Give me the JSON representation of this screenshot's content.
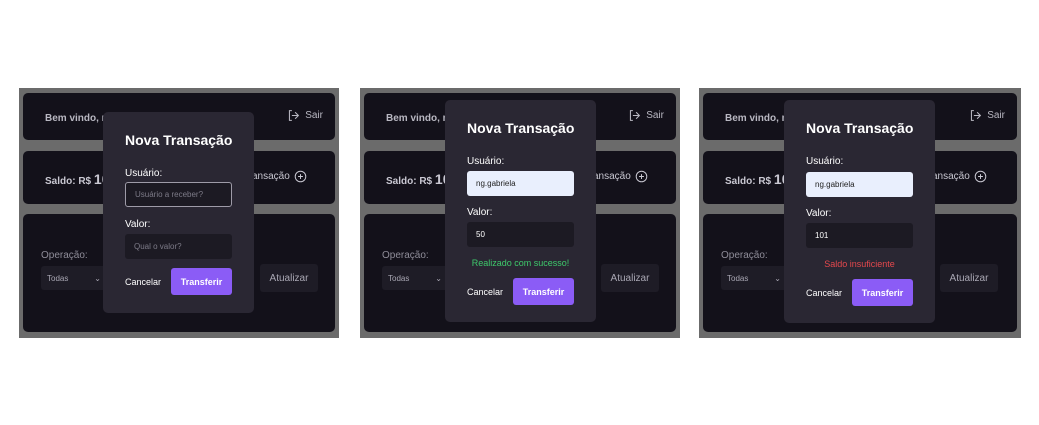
{
  "dashboard": {
    "greeting": "Bem vindo, n",
    "logout_label": "Sair",
    "balance_label": "Saldo: R$",
    "balance_value": "10",
    "new_transaction_label": "ansação",
    "operation_label": "Operação:",
    "operation_selected": "Todas",
    "refresh_label": "Atualizar"
  },
  "modals": [
    {
      "title": "Nova Transação",
      "user_label": "Usuário:",
      "user_value": "",
      "user_placeholder": "Usuário a receber?",
      "value_label": "Valor:",
      "value_value": "",
      "value_placeholder": "Qual o valor?",
      "message": "",
      "cancel_label": "Cancelar",
      "submit_label": "Transferir"
    },
    {
      "title": "Nova Transação",
      "user_label": "Usuário:",
      "user_value": "ng.gabriela",
      "value_label": "Valor:",
      "value_value": "50",
      "message": "Realizado com sucesso!",
      "message_color": "#3ec96b",
      "cancel_label": "Cancelar",
      "submit_label": "Transferir"
    },
    {
      "title": "Nova Transação",
      "user_label": "Usuário:",
      "user_value": "ng.gabriela",
      "value_label": "Valor:",
      "value_value": "101",
      "message": "Saldo insuficiente",
      "message_color": "#e5484d",
      "cancel_label": "Cancelar",
      "submit_label": "Transferir"
    }
  ],
  "colors": {
    "accent": "#8b5cf6",
    "success": "#3ec96b",
    "error": "#e5484d"
  }
}
